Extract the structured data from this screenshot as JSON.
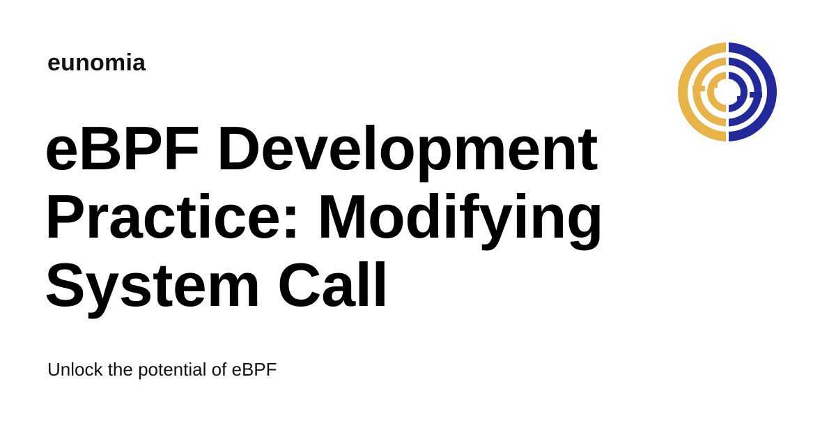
{
  "site": {
    "name": "eunomia"
  },
  "article": {
    "title": "eBPF Development Practice: Modifying System Call",
    "subtitle": "Unlock the potential of eBPF"
  },
  "logo": {
    "icon": "eunomia-logo-icon",
    "colors": {
      "gold": "#E8B44A",
      "navy": "#23289A"
    }
  }
}
